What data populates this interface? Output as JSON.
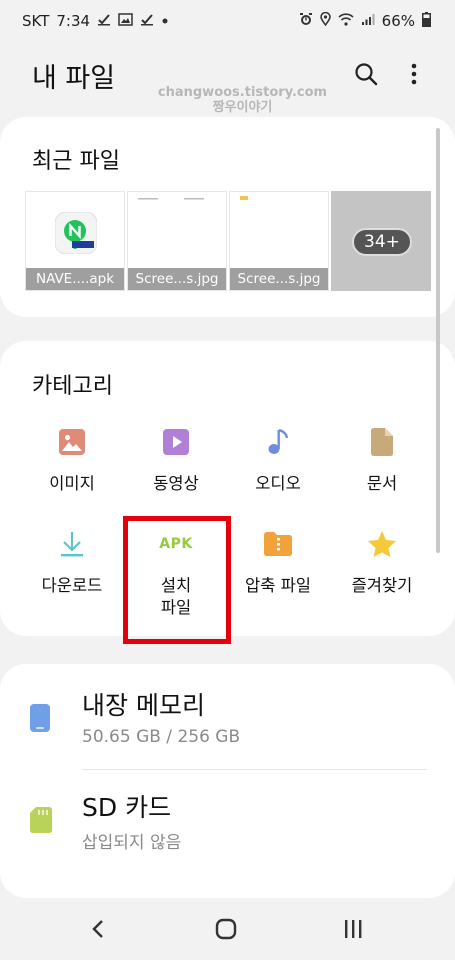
{
  "status_bar": {
    "carrier": "SKT",
    "time": "7:34",
    "battery": "66%",
    "left_icons": [
      "check-icon",
      "image-icon",
      "check-icon",
      "dot-icon"
    ],
    "right_icons": [
      "alarm-icon",
      "location-icon",
      "wifi-icon",
      "signal-icon",
      "battery-icon"
    ]
  },
  "header": {
    "title": "내 파일",
    "watermark_line1": "changwoos.tistory.com",
    "watermark_line2": "짱우이야기"
  },
  "recent": {
    "title": "최근 파일",
    "items": [
      {
        "caption": "NAVE....apk",
        "icon": "naver-app-icon"
      },
      {
        "caption": "Scree...s.jpg",
        "icon": "screenshot-thumbnail"
      },
      {
        "caption": "Scree...s.jpg",
        "icon": "screenshot-thumbnail"
      }
    ],
    "more_label": "34+"
  },
  "categories": {
    "title": "카테고리",
    "items": [
      {
        "label": "이미지",
        "icon": "image-icon",
        "color": "#e08a78"
      },
      {
        "label": "동영상",
        "icon": "video-icon",
        "color": "#b07fd6"
      },
      {
        "label": "오디오",
        "icon": "audio-icon",
        "color": "#6f8de0"
      },
      {
        "label": "문서",
        "icon": "document-icon",
        "color": "#c8a97a"
      },
      {
        "label": "다운로드",
        "icon": "download-icon",
        "color": "#5bc6c9"
      },
      {
        "label": "설치\n파일",
        "icon": "apk-icon",
        "icon_text": "APK",
        "color": "#97c93d"
      },
      {
        "label": "압축 파일",
        "icon": "zip-folder-icon",
        "color": "#f2a23a"
      },
      {
        "label": "즐겨찾기",
        "icon": "star-icon",
        "color": "#f5c93a"
      }
    ],
    "highlighted": "설치\n파일",
    "highlight_color": "#e3000f"
  },
  "storage": {
    "internal": {
      "title": "내장 메모리",
      "subtitle": "50.65 GB / 256 GB",
      "icon": "phone-storage-icon",
      "color": "#6fa0e6"
    },
    "sd": {
      "title": "SD 카드",
      "subtitle": "삽입되지 않음",
      "icon": "sd-card-icon",
      "color": "#b8d25a"
    }
  },
  "nav": {
    "buttons": [
      "back-icon",
      "home-icon",
      "recents-icon"
    ]
  }
}
